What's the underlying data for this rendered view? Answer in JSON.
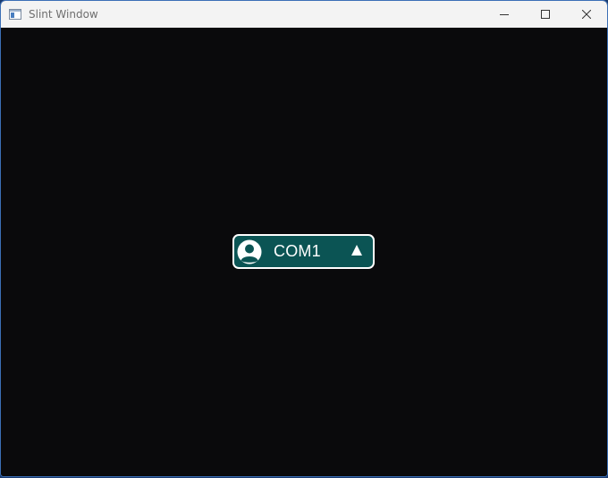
{
  "window": {
    "title": "Slint Window",
    "icons": {
      "app": "app-window-icon",
      "minimize": "minimize-icon",
      "maximize": "maximize-icon",
      "close": "close-icon"
    }
  },
  "combo": {
    "selected": "COM1",
    "avatar_icon": "user-avatar-icon",
    "caret_icon": "triangle-up-icon",
    "colors": {
      "background": "#0b5454",
      "border": "#ffffff",
      "text": "#ffffff"
    }
  },
  "colors": {
    "client_background": "#0a0a0c",
    "titlebar": "#f3f3f3"
  }
}
